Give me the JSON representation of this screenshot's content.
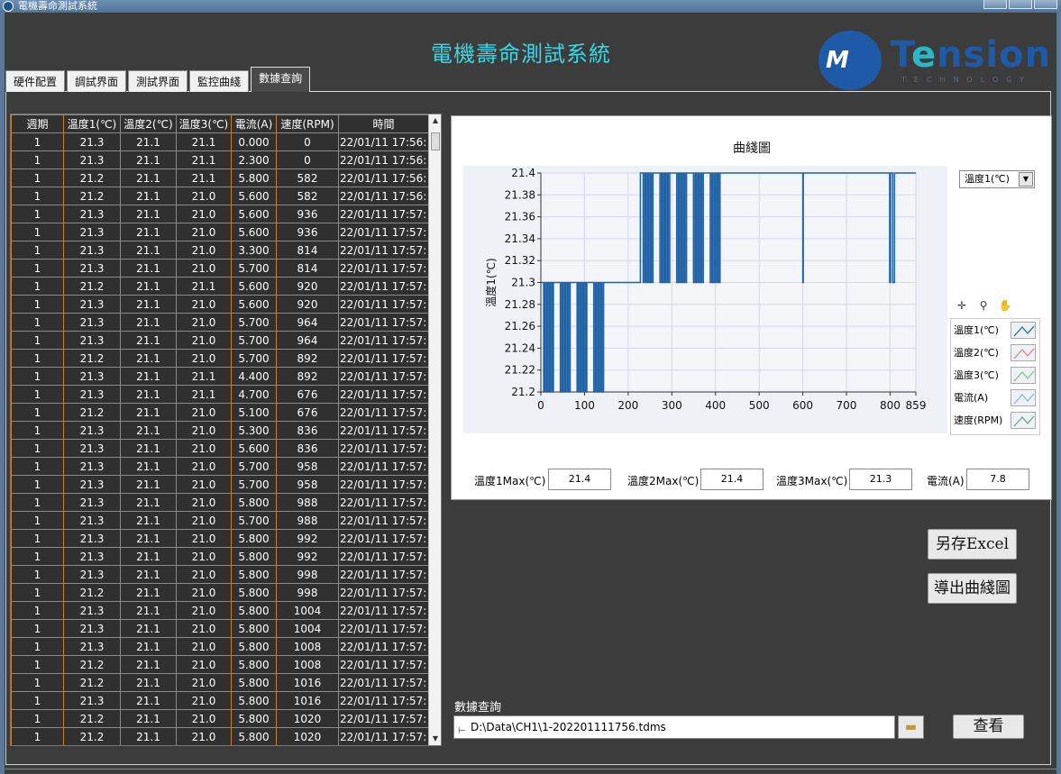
{
  "window": {
    "title": "電機壽命測試系統"
  },
  "app": {
    "title": "電機壽命測試系統",
    "logo": {
      "mark": "M",
      "word_pre": "T",
      "word_e": "e",
      "word_post": "nsion",
      "sub": "TECHNOLOGY"
    }
  },
  "tabs": [
    {
      "label": "硬件配置",
      "active": false
    },
    {
      "label": "調試界面",
      "active": false
    },
    {
      "label": "測試界面",
      "active": false
    },
    {
      "label": "監控曲綫",
      "active": false
    },
    {
      "label": "數據查詢",
      "active": true
    }
  ],
  "table": {
    "headers": [
      "週期",
      "溫度1(℃)",
      "溫度2(℃)",
      "溫度3(℃)",
      "電流(A)",
      "速度(RPM)",
      "時間"
    ],
    "rows": [
      [
        "1",
        "21.3",
        "21.1",
        "21.1",
        "0.000",
        "0",
        "22/01/11 17:56:"
      ],
      [
        "1",
        "21.3",
        "21.1",
        "21.1",
        "2.300",
        "0",
        "22/01/11 17:56:"
      ],
      [
        "1",
        "21.2",
        "21.1",
        "21.1",
        "5.800",
        "582",
        "22/01/11 17:56:"
      ],
      [
        "1",
        "21.2",
        "21.1",
        "21.0",
        "5.600",
        "582",
        "22/01/11 17:56:"
      ],
      [
        "1",
        "21.3",
        "21.1",
        "21.0",
        "5.600",
        "936",
        "22/01/11 17:57:"
      ],
      [
        "1",
        "21.3",
        "21.1",
        "21.0",
        "5.600",
        "936",
        "22/01/11 17:57:"
      ],
      [
        "1",
        "21.3",
        "21.1",
        "21.0",
        "3.300",
        "814",
        "22/01/11 17:57:"
      ],
      [
        "1",
        "21.3",
        "21.1",
        "21.0",
        "5.700",
        "814",
        "22/01/11 17:57:"
      ],
      [
        "1",
        "21.2",
        "21.1",
        "21.1",
        "5.600",
        "920",
        "22/01/11 17:57:"
      ],
      [
        "1",
        "21.3",
        "21.1",
        "21.0",
        "5.600",
        "920",
        "22/01/11 17:57:"
      ],
      [
        "1",
        "21.3",
        "21.1",
        "21.0",
        "5.700",
        "964",
        "22/01/11 17:57:"
      ],
      [
        "1",
        "21.3",
        "21.1",
        "21.0",
        "5.700",
        "964",
        "22/01/11 17:57:"
      ],
      [
        "1",
        "21.2",
        "21.1",
        "21.0",
        "5.700",
        "892",
        "22/01/11 17:57:"
      ],
      [
        "1",
        "21.3",
        "21.1",
        "21.1",
        "4.400",
        "892",
        "22/01/11 17:57:"
      ],
      [
        "1",
        "21.3",
        "21.1",
        "21.1",
        "4.700",
        "676",
        "22/01/11 17:57:"
      ],
      [
        "1",
        "21.2",
        "21.1",
        "21.0",
        "5.100",
        "676",
        "22/01/11 17:57:"
      ],
      [
        "1",
        "21.3",
        "21.1",
        "21.0",
        "5.300",
        "836",
        "22/01/11 17:57:"
      ],
      [
        "1",
        "21.3",
        "21.1",
        "21.0",
        "5.600",
        "836",
        "22/01/11 17:57:"
      ],
      [
        "1",
        "21.3",
        "21.1",
        "21.0",
        "5.700",
        "958",
        "22/01/11 17:57:"
      ],
      [
        "1",
        "21.3",
        "21.1",
        "21.0",
        "5.700",
        "958",
        "22/01/11 17:57:"
      ],
      [
        "1",
        "21.3",
        "21.1",
        "21.0",
        "5.800",
        "988",
        "22/01/11 17:57:"
      ],
      [
        "1",
        "21.3",
        "21.1",
        "21.0",
        "5.700",
        "988",
        "22/01/11 17:57:"
      ],
      [
        "1",
        "21.3",
        "21.1",
        "21.0",
        "5.800",
        "992",
        "22/01/11 17:57:"
      ],
      [
        "1",
        "21.3",
        "21.1",
        "21.0",
        "5.800",
        "992",
        "22/01/11 17:57:"
      ],
      [
        "1",
        "21.3",
        "21.1",
        "21.0",
        "5.800",
        "998",
        "22/01/11 17:57:"
      ],
      [
        "1",
        "21.2",
        "21.1",
        "21.0",
        "5.800",
        "998",
        "22/01/11 17:57:"
      ],
      [
        "1",
        "21.3",
        "21.1",
        "21.0",
        "5.800",
        "1004",
        "22/01/11 17:57:"
      ],
      [
        "1",
        "21.3",
        "21.1",
        "21.0",
        "5.800",
        "1004",
        "22/01/11 17:57:"
      ],
      [
        "1",
        "21.3",
        "21.1",
        "21.0",
        "5.800",
        "1008",
        "22/01/11 17:57:"
      ],
      [
        "1",
        "21.2",
        "21.1",
        "21.0",
        "5.800",
        "1008",
        "22/01/11 17:57:"
      ],
      [
        "1",
        "21.2",
        "21.1",
        "21.0",
        "5.800",
        "1016",
        "22/01/11 17:57:"
      ],
      [
        "1",
        "21.3",
        "21.1",
        "21.0",
        "5.800",
        "1016",
        "22/01/11 17:57:"
      ],
      [
        "1",
        "21.2",
        "21.1",
        "21.0",
        "5.800",
        "1020",
        "22/01/11 17:57:"
      ],
      [
        "1",
        "21.2",
        "21.1",
        "21.0",
        "5.800",
        "1020",
        "22/01/11 17:57:"
      ]
    ]
  },
  "chart": {
    "selector_value": "溫度1(℃)",
    "palette_icons": [
      "crosshair-icon",
      "zoom-icon",
      "hand-icon"
    ],
    "legend": [
      {
        "label": "溫度1(℃)",
        "color": "#1f62a6"
      },
      {
        "label": "溫度2(℃)",
        "color": "#e07d7d"
      },
      {
        "label": "溫度3(℃)",
        "color": "#7cc47c"
      },
      {
        "label": "電流(A)",
        "color": "#7db6e0"
      },
      {
        "label": "速度(RPM)",
        "color": "#6aa08a"
      }
    ]
  },
  "chart_data": {
    "type": "line",
    "title": "曲綫圖",
    "ylabel": "溫度1(℃)",
    "xlabel": "",
    "xlim": [
      0,
      859
    ],
    "ylim": [
      21.2,
      21.4
    ],
    "xticks": [
      "0",
      "100",
      "200",
      "300",
      "400",
      "500",
      "600",
      "700",
      "800",
      "859"
    ],
    "yticks": [
      "21.4",
      "21.38",
      "21.36",
      "21.34",
      "21.32",
      "21.3",
      "21.28",
      "21.26",
      "21.24",
      "21.22",
      "21.2"
    ],
    "series": [
      {
        "name": "溫度1(℃)",
        "color": "#1f62a6",
        "segments": [
          {
            "x_start": 0,
            "x_end": 150,
            "levels": [
              21.2,
              21.3
            ],
            "pattern": "rapid alternation"
          },
          {
            "x_start": 150,
            "x_end": 228,
            "levels": [
              21.3
            ],
            "pattern": "flat"
          },
          {
            "x_start": 228,
            "x_end": 420,
            "levels": [
              21.3,
              21.4
            ],
            "pattern": "rapid alternation"
          },
          {
            "x_start": 420,
            "x_end": 600,
            "levels": [
              21.4
            ],
            "pattern": "flat"
          },
          {
            "x_start": 600,
            "x_end": 601,
            "levels": [
              21.3
            ],
            "pattern": "dip"
          },
          {
            "x_start": 601,
            "x_end": 798,
            "levels": [
              21.4
            ],
            "pattern": "flat"
          },
          {
            "x_start": 798,
            "x_end": 810,
            "levels": [
              21.3,
              21.4
            ],
            "pattern": "dips"
          },
          {
            "x_start": 810,
            "x_end": 859,
            "levels": [
              21.4
            ],
            "pattern": "flat"
          }
        ]
      }
    ]
  },
  "stats": [
    {
      "label": "溫度1Max(℃)",
      "value": "21.4"
    },
    {
      "label": "溫度2Max(℃)",
      "value": "21.4"
    },
    {
      "label": "溫度3Max(℃)",
      "value": "21.3"
    },
    {
      "label": "電流(A)",
      "value": "7.8"
    }
  ],
  "buttons": {
    "save_excel": "另存Excel",
    "export_chart": "導出曲綫圖",
    "view": "查看"
  },
  "query": {
    "label": "數據查詢",
    "path": "D:\\Data\\CH1\\1-202201111756.tdms"
  }
}
